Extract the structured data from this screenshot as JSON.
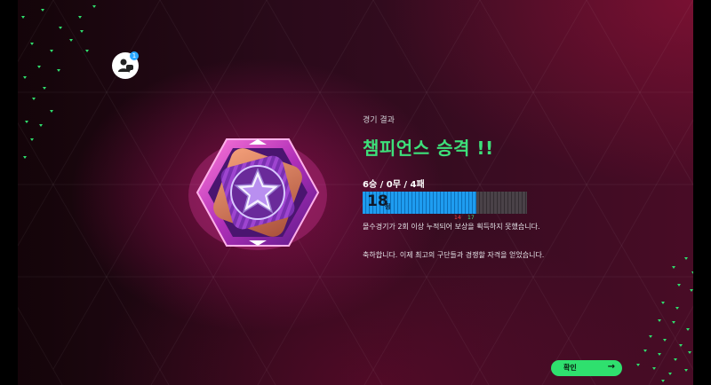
{
  "profile": {
    "badge": "1"
  },
  "result": {
    "section_label": "경기 결과",
    "headline": "챔피언스 승격 !!",
    "record": "6승 / 0무 / 4패",
    "score": "18",
    "score_unit": "점",
    "gauge_progress": 0.69,
    "tick_red": "14",
    "tick_green": "17",
    "note": "몰수경기가 2회 이상 누적되어 보상을 획득하지 못했습니다.",
    "congrats": "축하합니다. 이제 최고의 구단들과 경쟁할 자격을 얻었습니다."
  },
  "confirm_button": {
    "label": "확인"
  },
  "colors": {
    "accent_green": "#3de07a",
    "gauge_blue": "#1e9cf0",
    "red_tick": "#ff4040"
  }
}
